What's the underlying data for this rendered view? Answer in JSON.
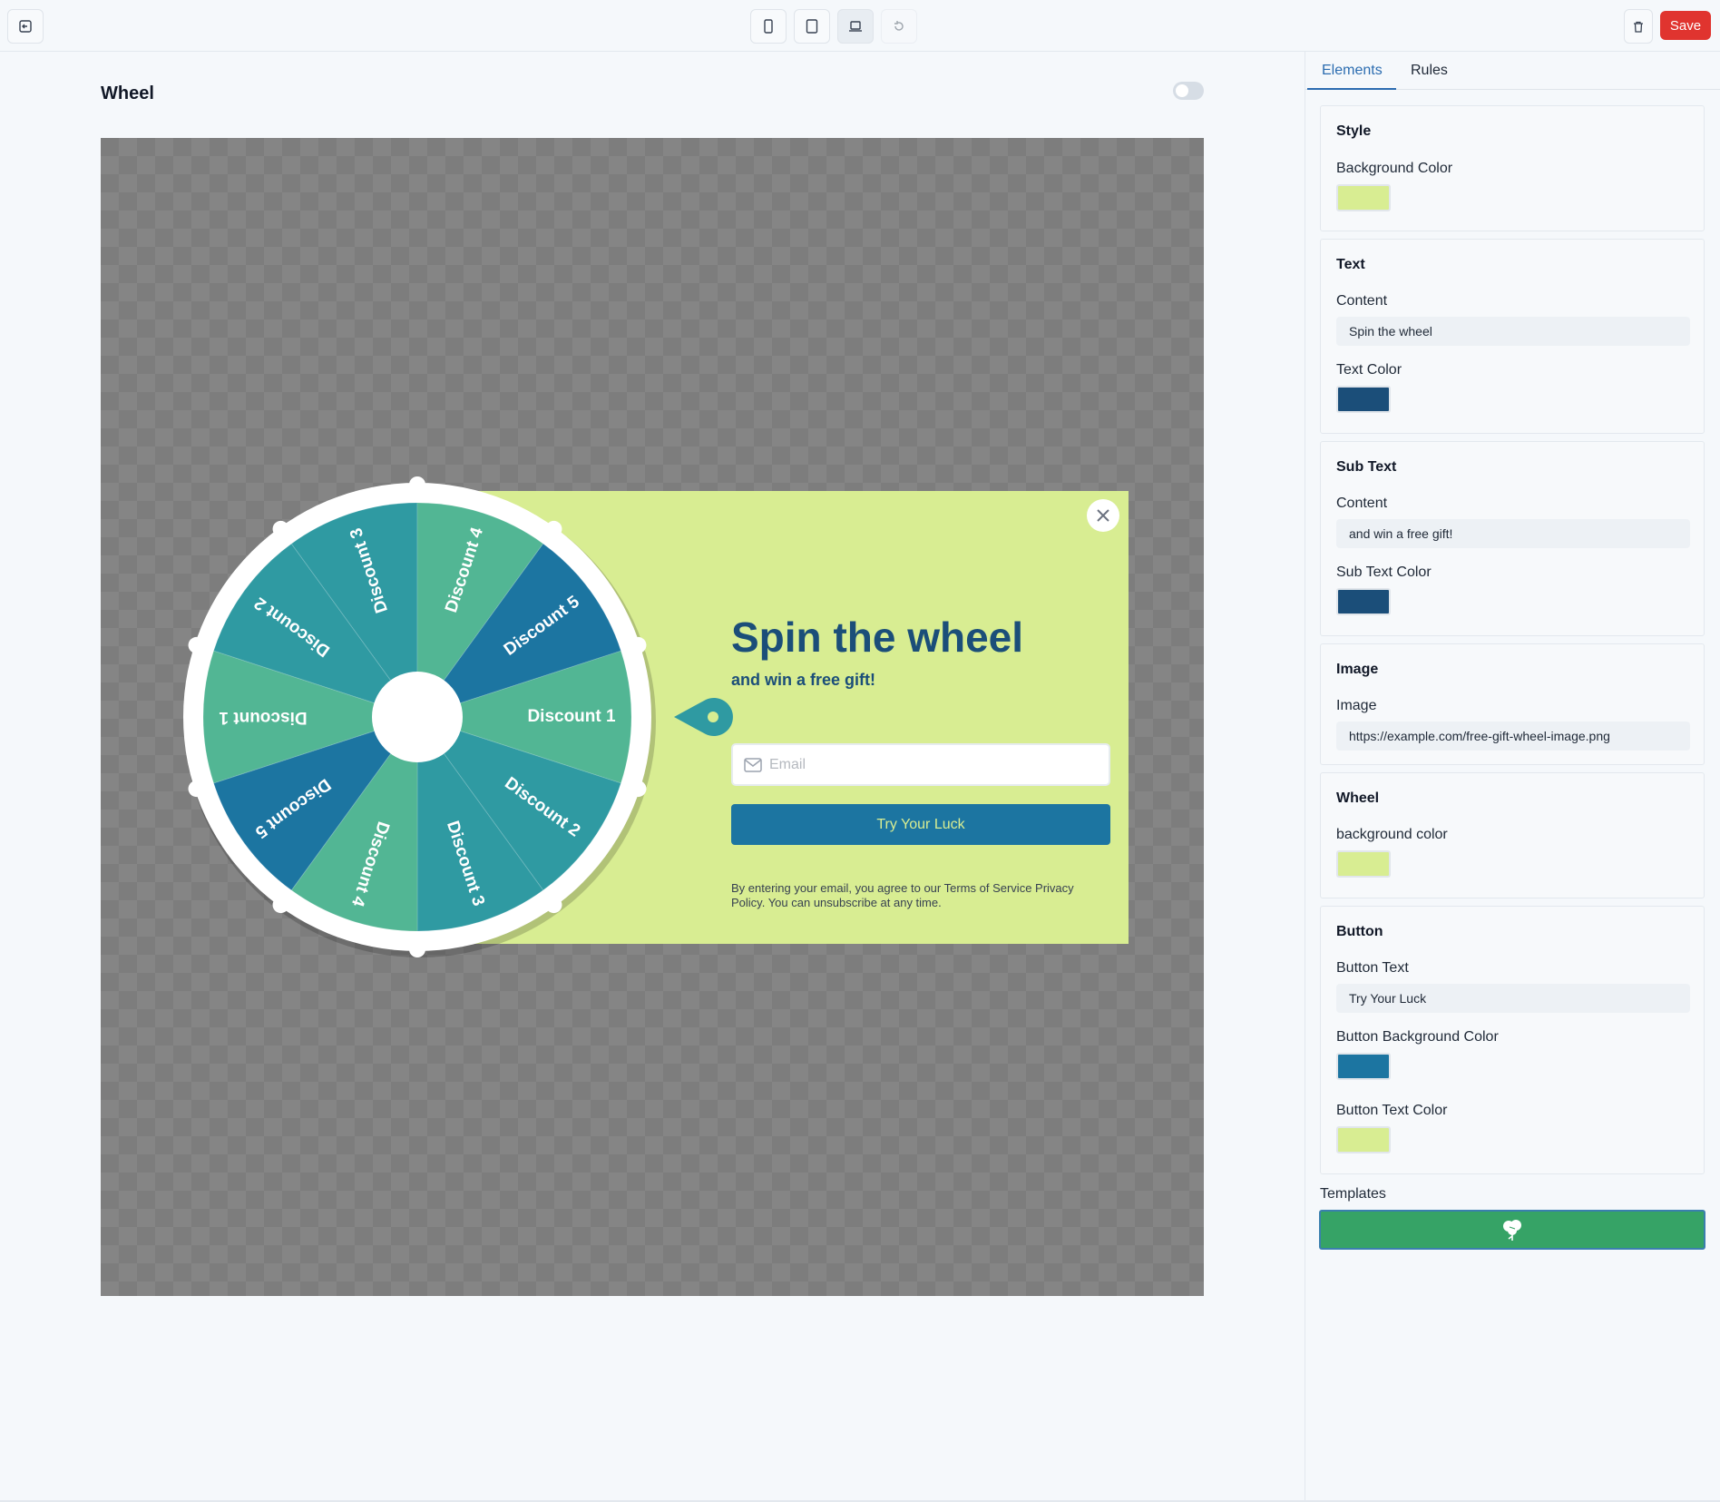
{
  "page": {
    "title": "Wheel"
  },
  "toolbar": {
    "save_label": "Save"
  },
  "popup": {
    "title": "Spin the wheel",
    "subtitle": "and win a free gift!",
    "email_placeholder": "Email",
    "button_label": "Try Your Luck",
    "legal": "By entering your email, you agree to our Terms of Service Privacy Policy. You can unsubscribe at any time.",
    "wheel_segments": [
      "Discount 1",
      "Discount 2",
      "Discount 3",
      "Discount 4",
      "Discount 5",
      "Discount 1",
      "Discount 2",
      "Discount 3",
      "Discount 4",
      "Discount 5"
    ],
    "colors": {
      "background": "#d8ed92",
      "text": "#1b4e79",
      "button_bg": "#1c75a1",
      "button_text": "#d8ed92"
    }
  },
  "panel": {
    "tabs": [
      "Elements",
      "Rules"
    ],
    "style": {
      "title": "Style",
      "bg_label": "Background Color",
      "bg_color": "#d8ed92"
    },
    "text": {
      "title": "Text",
      "content_label": "Content",
      "content_value": "Spin the wheel",
      "color_label": "Text Color",
      "color": "#1b4e79"
    },
    "subtext": {
      "title": "Sub Text",
      "content_label": "Content",
      "content_value": "and win a free gift!",
      "color_label": "Sub Text Color",
      "color": "#1b4e79"
    },
    "image": {
      "title": "Image",
      "label": "Image",
      "value": "https://example.com/free-gift-wheel-image.png"
    },
    "wheel": {
      "title": "Wheel",
      "bg_label": "background color",
      "bg_color": "#d8ed92"
    },
    "button": {
      "title": "Button",
      "text_label": "Button Text",
      "text_value": "Try Your Luck",
      "bg_label": "Button Background Color",
      "bg_color": "#1c75a1",
      "color_label": "Button Text Color",
      "color": "#d8ed92"
    },
    "templates_label": "Templates"
  },
  "icons": [
    "exit-icon",
    "phone-icon",
    "tablet-icon",
    "laptop-icon",
    "reset-icon",
    "delete-icon",
    "close-icon",
    "mail-icon",
    "template-flower-icon"
  ]
}
